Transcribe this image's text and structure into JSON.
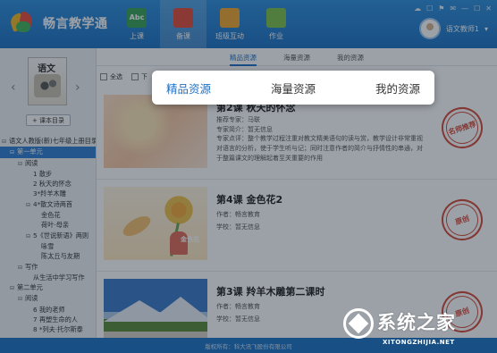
{
  "app": {
    "name": "畅言教学通"
  },
  "nav": [
    {
      "label": "上课",
      "icon": "abc-board-icon",
      "icon_text": "Abc",
      "color": "#3aa357"
    },
    {
      "label": "备课",
      "icon": "book-icon",
      "icon_text": "",
      "color": "#e24c3b"
    },
    {
      "label": "班级互动",
      "icon": "windows-grid-icon",
      "icon_text": "",
      "color": "#f0a830"
    },
    {
      "label": "作业",
      "icon": "homework-icon",
      "icon_text": "",
      "color": "#7fc24b"
    }
  ],
  "user": {
    "name": "语文教师1",
    "dropdown": "▾"
  },
  "window_controls": [
    "☁",
    "☐",
    "⚑",
    "✉",
    "—",
    "☐",
    "✕"
  ],
  "sidebar": {
    "book_glyph": "语文",
    "catalog_button": "+ 课本目录",
    "tree": [
      {
        "label": "语文人教版(新)七年级上册目录",
        "level": 0,
        "toggle": "⊟"
      },
      {
        "label": "第一单元",
        "level": 1,
        "toggle": "⊟",
        "selected": true
      },
      {
        "label": "阅读",
        "level": 2,
        "toggle": "⊟"
      },
      {
        "label": "1 散步",
        "level": 3,
        "toggle": ""
      },
      {
        "label": "2 秋天的怀念",
        "level": 3,
        "toggle": ""
      },
      {
        "label": "3*羚羊木雕",
        "level": 3,
        "toggle": ""
      },
      {
        "label": "4*散文诗两首",
        "level": 3,
        "toggle": "⊟"
      },
      {
        "label": "金色花",
        "level": 4,
        "toggle": ""
      },
      {
        "label": "荷叶·母亲",
        "level": 4,
        "toggle": ""
      },
      {
        "label": "5《世说新语》两则",
        "level": 3,
        "toggle": "⊟"
      },
      {
        "label": "咏雪",
        "level": 4,
        "toggle": ""
      },
      {
        "label": "陈太丘与友期",
        "level": 4,
        "toggle": ""
      },
      {
        "label": "写作",
        "level": 2,
        "toggle": "⊟"
      },
      {
        "label": "从生活中学习写作",
        "level": 3,
        "toggle": ""
      },
      {
        "label": "第二单元",
        "level": 1,
        "toggle": "⊟"
      },
      {
        "label": "阅读",
        "level": 2,
        "toggle": "⊟"
      },
      {
        "label": "6 我的老师",
        "level": 3,
        "toggle": ""
      },
      {
        "label": "7 再塑生命的人",
        "level": 3,
        "toggle": ""
      },
      {
        "label": "8 *列夫·托尔斯泰",
        "level": 3,
        "toggle": ""
      }
    ]
  },
  "tabs": [
    {
      "label": "精品资源",
      "active": true
    },
    {
      "label": "海量资源",
      "active": false
    },
    {
      "label": "我的资源",
      "active": false
    }
  ],
  "filter": {
    "all_label": "全选",
    "download_label": "下"
  },
  "resources": [
    {
      "title": "第2课 秋天的怀念",
      "meta1": "推荐专家：马联",
      "meta2": "专家简介：暂无信息",
      "desc": "专家点评：整个教学过程注重对教文精美语句的读与赏，教学设计非常重视对语言的分析，使于学生听与记；同时注意作者的简介与抒情性的串通，对于整篇课文的理解起着至关重要的作用",
      "stamp": "名师推荐"
    },
    {
      "title": "第4课 金色花2",
      "meta1": "作者：畅言教育",
      "meta2": "学校：暂无信息",
      "desc": "",
      "thumb_text": "金色花",
      "stamp": "原创"
    },
    {
      "title": "第3课 羚羊木雕第二课时",
      "meta1": "作者：畅言教育",
      "meta2": "学校：暂无信息",
      "desc": "",
      "stamp": "原创"
    }
  ],
  "popup": [
    "精品资源",
    "海量资源",
    "我的资源"
  ],
  "footer": "版权所有：科大讯飞股份有限公司",
  "watermark": {
    "main": "系统之家",
    "sub": "XITONGZHIJIA.NET"
  }
}
